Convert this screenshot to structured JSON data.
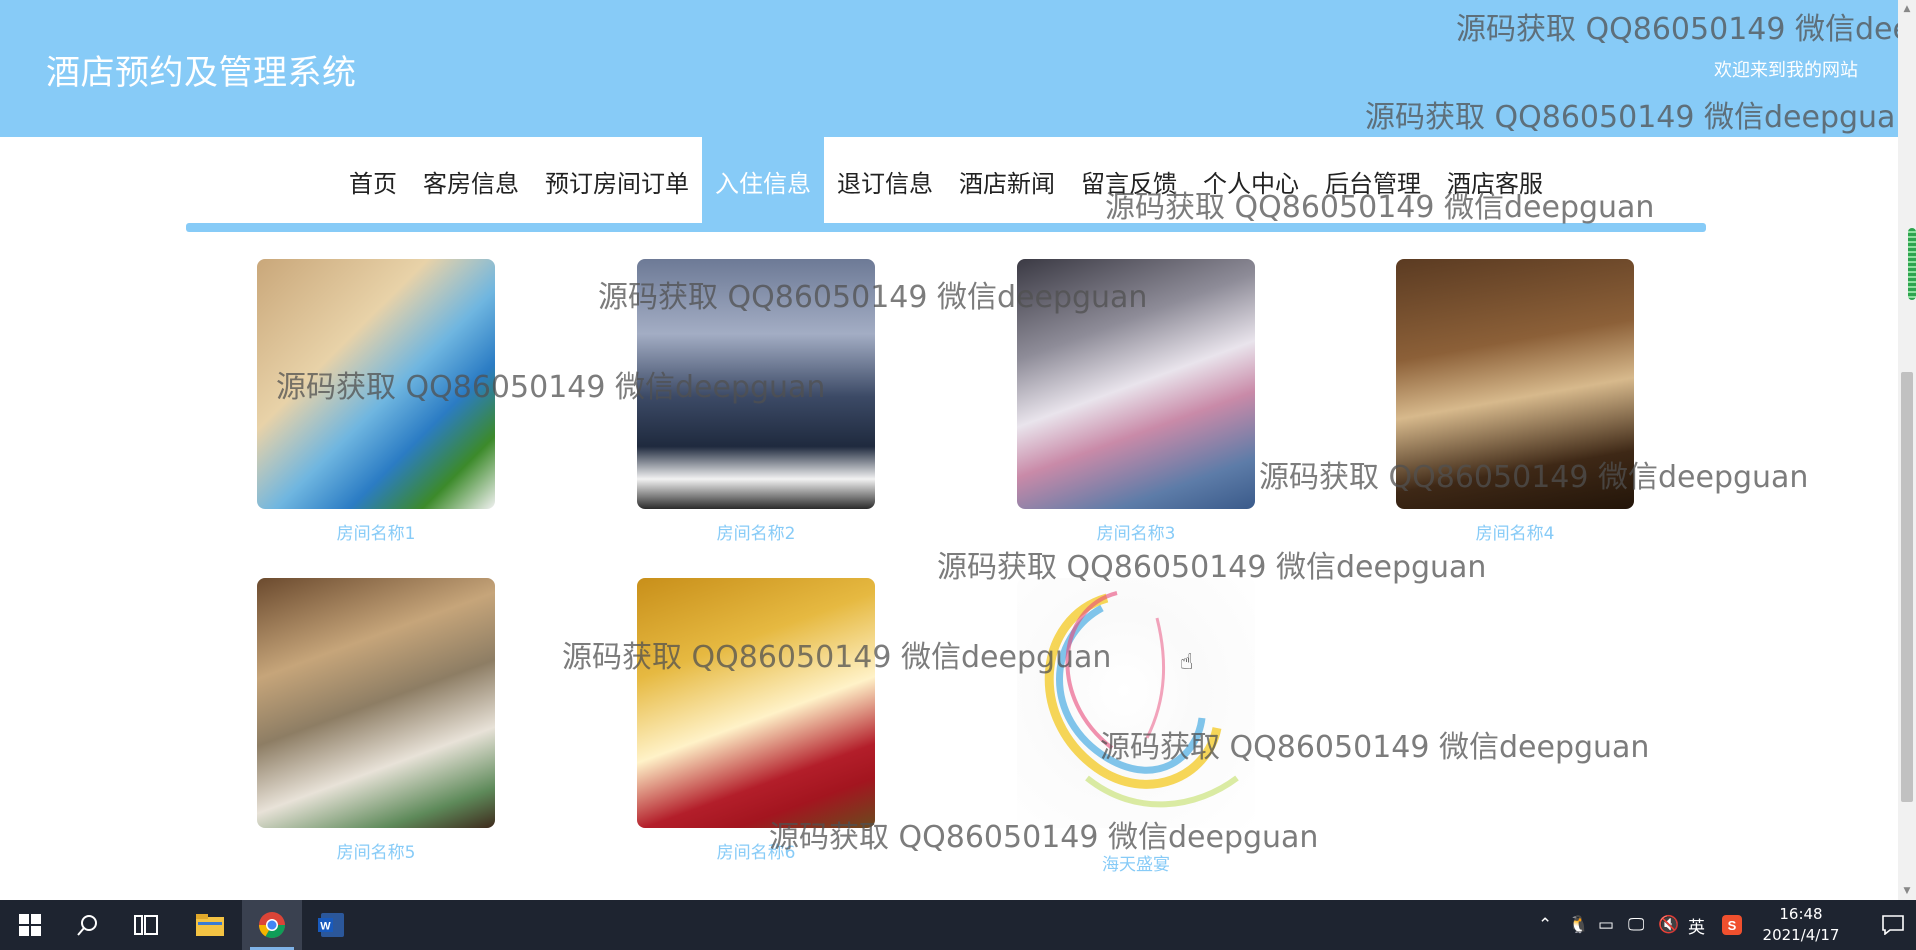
{
  "header": {
    "site_title": "酒店预约及管理系统",
    "welcome": "欢迎来到我的网站"
  },
  "nav": {
    "items": [
      {
        "label": "首页",
        "active": false
      },
      {
        "label": "客房信息",
        "active": false
      },
      {
        "label": "预订房间订单",
        "active": false
      },
      {
        "label": "入住信息",
        "active": true
      },
      {
        "label": "退订信息",
        "active": false
      },
      {
        "label": "酒店新闻",
        "active": false
      },
      {
        "label": "留言反馈",
        "active": false
      },
      {
        "label": "个人中心",
        "active": false
      },
      {
        "label": "后台管理",
        "active": false
      },
      {
        "label": "酒店客服",
        "active": false
      }
    ]
  },
  "rooms": [
    {
      "name": "房间名称1"
    },
    {
      "name": "房间名称2"
    },
    {
      "name": "房间名称3"
    },
    {
      "name": "房间名称4"
    },
    {
      "name": "房间名称5"
    },
    {
      "name": "房间名称6"
    },
    {
      "name": "海天盛宴"
    }
  ],
  "watermark": {
    "text": "源码获取 QQ86050149 微信deepguan",
    "text_cut": "源码获取 QQ86050149 微信deep"
  },
  "taskbar": {
    "icons": [
      "windows-start-icon",
      "search-icon",
      "task-view-icon",
      "file-explorer-icon",
      "chrome-icon",
      "word-icon"
    ],
    "tray": {
      "ime": "英",
      "time": "16:48",
      "date": "2021/4/17"
    }
  },
  "colors": {
    "accent": "#87CBF7",
    "taskbar": "#1e2430"
  }
}
